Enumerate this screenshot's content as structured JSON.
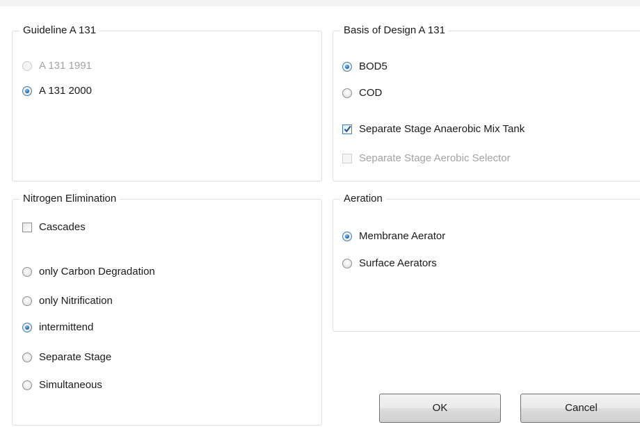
{
  "guideline": {
    "title": "Guideline A 131",
    "options": [
      {
        "label": "A 131 1991",
        "checked": false,
        "enabled": false
      },
      {
        "label": "A 131 2000",
        "checked": true,
        "enabled": true
      }
    ]
  },
  "basis": {
    "title": "Basis of Design A 131",
    "options": [
      {
        "label": "BOD5",
        "checked": true,
        "enabled": true
      },
      {
        "label": "COD",
        "checked": false,
        "enabled": true
      }
    ],
    "checkboxes": [
      {
        "label": "Separate Stage Anaerobic Mix Tank",
        "checked": true,
        "enabled": true
      },
      {
        "label": "Separate Stage Aerobic Selector",
        "checked": false,
        "enabled": false
      }
    ]
  },
  "nitrogen": {
    "title": "Nitrogen Elimination",
    "cascades": {
      "label": "Cascades",
      "checked": false,
      "enabled": true
    },
    "options": [
      {
        "label": "only Carbon Degradation",
        "checked": false,
        "enabled": true
      },
      {
        "label": "only Nitrification",
        "checked": false,
        "enabled": true
      },
      {
        "label": "intermittend",
        "checked": true,
        "enabled": true
      },
      {
        "label": "Separate Stage",
        "checked": false,
        "enabled": true
      },
      {
        "label": "Simultaneous",
        "checked": false,
        "enabled": true
      }
    ]
  },
  "aeration": {
    "title": "Aeration",
    "options": [
      {
        "label": "Membrane Aerator",
        "checked": true,
        "enabled": true
      },
      {
        "label": "Surface Aerators",
        "checked": false,
        "enabled": true
      }
    ]
  },
  "buttons": {
    "ok": "OK",
    "cancel": "Cancel"
  }
}
